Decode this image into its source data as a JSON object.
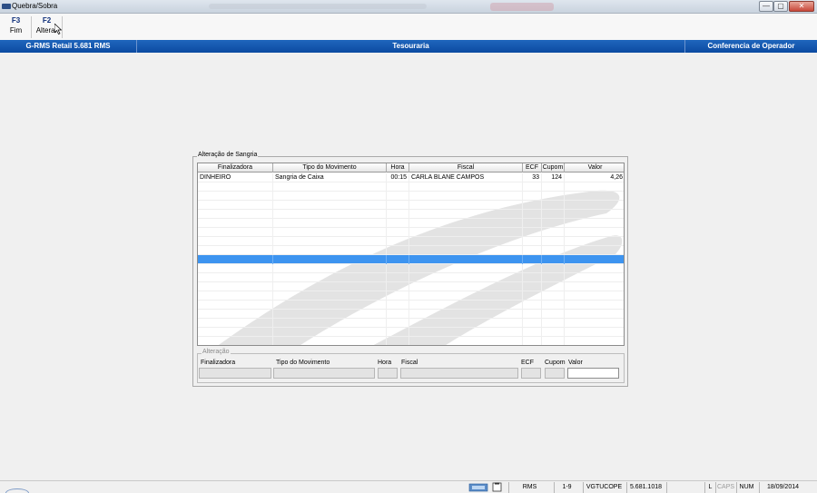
{
  "window": {
    "title": "Quebra/Sobra",
    "buttons": {
      "min": "—",
      "max": "▢",
      "close": "✕"
    }
  },
  "toolbar": [
    {
      "key": "F3",
      "label": "Fim"
    },
    {
      "key": "F2",
      "label": "Alterar"
    }
  ],
  "header": {
    "left": "G-RMS Retail 5.681 RMS",
    "center": "Tesouraria",
    "right": "Conferencia de Operador"
  },
  "panel": {
    "legend": "Alteração de Sangria",
    "columns": [
      "Finalizadora",
      "Tipo do Movimento",
      "Hora",
      "Fiscal",
      "ECF",
      "Cupom",
      "Valor"
    ],
    "rows": [
      {
        "finalizadora": "DINHEIRO",
        "tipo": "Sangria de Caixa",
        "hora": "00:15",
        "fiscal": "CARLA BLANE CAMPOS",
        "ecf": "33",
        "cupom": "124",
        "valor": "4,26"
      }
    ],
    "selected_row_index": 9
  },
  "alteracao": {
    "legend": "Alteração",
    "labels": [
      "Finalizadora",
      "Tipo do Movimento",
      "Hora",
      "Fiscal",
      "ECF",
      "Cupom",
      "Valor"
    ]
  },
  "statusbar": {
    "cells": [
      "RMS",
      "1-9",
      "VGTUCOPE",
      "5.681.1018",
      "",
      "L",
      "CAPS",
      "NUM",
      "18/09/2014"
    ]
  }
}
